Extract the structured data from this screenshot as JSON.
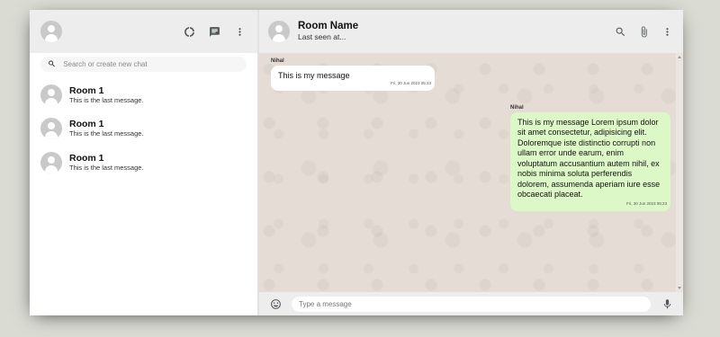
{
  "colors": {
    "outgoing_bubble": "#dcf8c6",
    "incoming_bubble": "#ffffff",
    "chat_background": "#e5ddd5",
    "header": "#ededed"
  },
  "sidebar": {
    "icons": [
      "donut-large-icon",
      "chat-icon",
      "more-vert-icon"
    ],
    "search": {
      "placeholder": "Search or create new chat"
    },
    "chats": [
      {
        "name": "Room 1",
        "last_message": "This is the last message."
      },
      {
        "name": "Room 1",
        "last_message": "This is the last message."
      },
      {
        "name": "Room 1",
        "last_message": "This is the last message."
      }
    ]
  },
  "chat": {
    "room_name": "Room Name",
    "last_seen": "Last seen at...",
    "icons": [
      "search-icon",
      "attach-file-icon",
      "more-vert-icon"
    ],
    "messages": [
      {
        "name": "Nihal",
        "text": "This is my message",
        "timestamp": "Fri, 30 Jun 2023 05:23",
        "outgoing": false
      },
      {
        "name": "Nihal",
        "text": "This is my message Lorem ipsum dolor sit amet consectetur, adipisicing elit. Doloremque iste distinctio corrupti non ullam error unde earum, enim voluptatum accusantium autem nihil, ex nobis minima soluta perferendis dolorem, assumenda aperiam iure esse obcaecati placeat.",
        "timestamp": "Fri, 30 Jun 2023 05:23",
        "outgoing": true
      }
    ],
    "footer": {
      "placeholder": "Type a message",
      "icons": [
        "emoji-icon",
        "mic-icon"
      ]
    }
  }
}
